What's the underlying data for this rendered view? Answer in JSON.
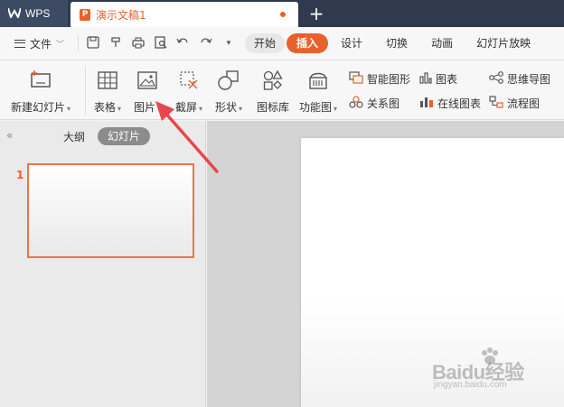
{
  "titlebar": {
    "app_tab": "WPS",
    "doc_tab": "演示文稿1",
    "new_tab_symbol": "+"
  },
  "menubar": {
    "file_label": "文件",
    "tabs": [
      "开始",
      "插入",
      "设计",
      "切换",
      "动画",
      "幻灯片放映"
    ],
    "active_tab": "插入",
    "quick_icons": [
      "save-icon",
      "format-painter-icon",
      "print-icon",
      "print-preview-icon",
      "undo-icon",
      "redo-icon",
      "customize-icon"
    ]
  },
  "ribbon": {
    "new_slide": "新建幻灯片",
    "table": "表格",
    "picture": "图片",
    "screenshot": "截屏",
    "shape": "形状",
    "icon_library": "图标库",
    "function_chart": "功能图",
    "smart_art": "智能图形",
    "chart": "图表",
    "mind_map": "思维导图",
    "relation_chart": "关系图",
    "online_chart": "在线图表",
    "flowchart": "流程图"
  },
  "left_panel": {
    "outline_tab": "大纲",
    "slides_tab": "幻灯片",
    "slides": [
      {
        "number": "1"
      }
    ]
  },
  "watermark": {
    "brand": "Baidu经验",
    "url": "jingyan.baidu.com"
  },
  "colors": {
    "accent": "#e8612c",
    "titlebar": "#2f3a4f",
    "annotation_arrow": "#e8464e"
  }
}
